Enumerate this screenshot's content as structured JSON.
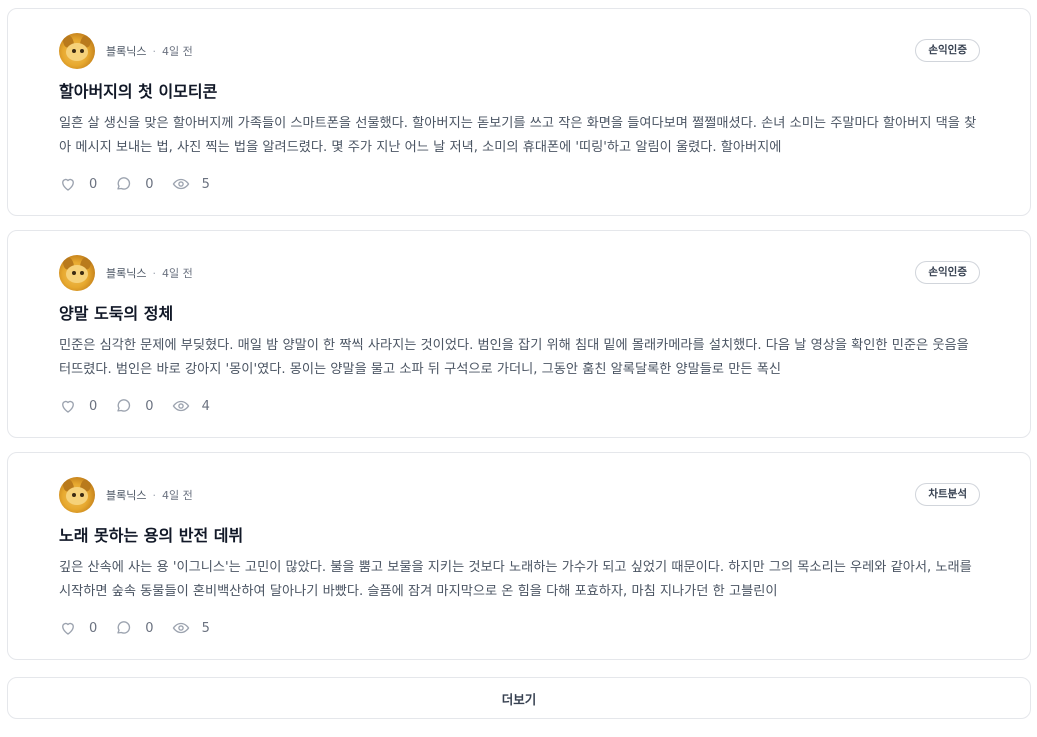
{
  "posts": [
    {
      "author": "블록닉스",
      "time": "4일 전",
      "badge": "손익인증",
      "title": "할아버지의 첫 이모티콘",
      "body": "일흔 살 생신을 맞은 할아버지께 가족들이 스마트폰을 선물했다. 할아버지는 돋보기를 쓰고 작은 화면을 들여다보며 쩔쩔매셨다. 손녀 소미는 주말마다 할아버지 댁을 찾아 메시지 보내는 법, 사진 찍는 법을 알려드렸다. 몇 주가 지난 어느 날 저녁, 소미의 휴대폰에 '띠링'하고 알림이 울렸다. 할아버지에",
      "likes": "0",
      "comments": "0",
      "views": "5"
    },
    {
      "author": "블록닉스",
      "time": "4일 전",
      "badge": "손익인증",
      "title": "양말 도둑의 정체",
      "body": "민준은 심각한 문제에 부딪혔다. 매일 밤 양말이 한 짝씩 사라지는 것이었다. 범인을 잡기 위해 침대 밑에 몰래카메라를 설치했다. 다음 날 영상을 확인한 민준은 웃음을 터뜨렸다. 범인은 바로 강아지 '몽이'였다. 몽이는 양말을 물고 소파 뒤 구석으로 가더니, 그동안 훔친 알록달록한 양말들로 만든 폭신",
      "likes": "0",
      "comments": "0",
      "views": "4"
    },
    {
      "author": "블록닉스",
      "time": "4일 전",
      "badge": "차트분석",
      "title": "노래 못하는 용의 반전 데뷔",
      "body": "깊은 산속에 사는 용 '이그니스'는 고민이 많았다. 불을 뿜고 보물을 지키는 것보다 노래하는 가수가 되고 싶었기 때문이다. 하지만 그의 목소리는 우레와 같아서, 노래를 시작하면 숲속 동물들이 혼비백산하여 달아나기 바빴다. 슬픔에 잠겨 마지막으로 온 힘을 다해 포효하자, 마침 지나가던 한 고블린이",
      "likes": "0",
      "comments": "0",
      "views": "5"
    }
  ],
  "separator": "·",
  "more_label": "더보기",
  "icons": {
    "like": "heart-icon",
    "comment": "comment-icon",
    "view": "eye-icon"
  },
  "colors": {
    "border": "#e5e7eb",
    "text_muted": "#6b7280",
    "icon": "#9ca3af"
  }
}
